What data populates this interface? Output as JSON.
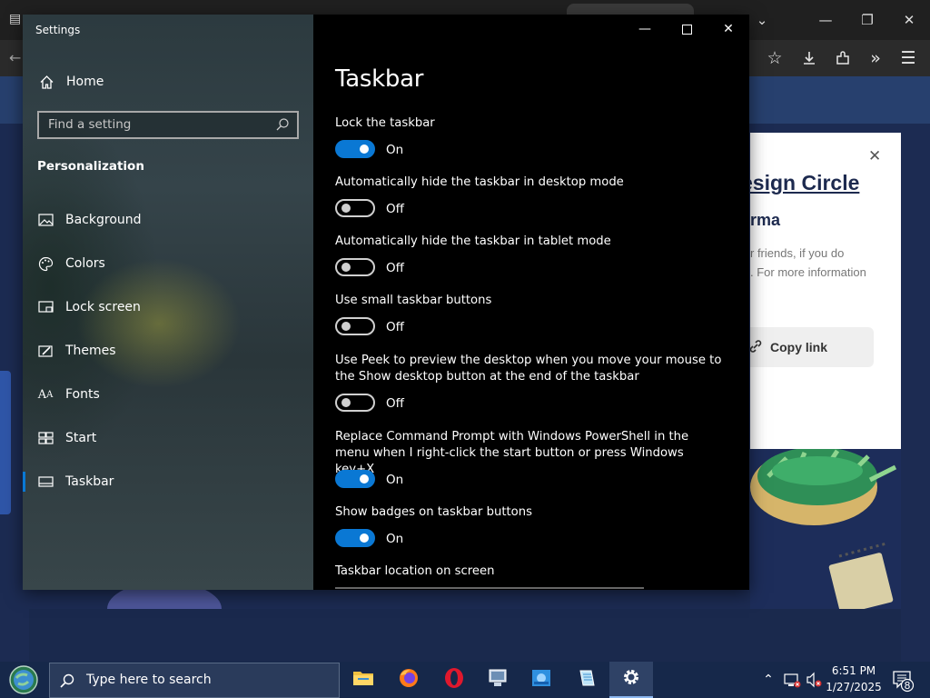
{
  "settings": {
    "window_title": "Settings",
    "nav": {
      "home": "Home",
      "search_placeholder": "Find a setting",
      "section": "Personalization",
      "items": [
        {
          "label": "Background",
          "icon": "picture-icon"
        },
        {
          "label": "Colors",
          "icon": "palette-icon"
        },
        {
          "label": "Lock screen",
          "icon": "lock-screen-icon"
        },
        {
          "label": "Themes",
          "icon": "brush-icon"
        },
        {
          "label": "Fonts",
          "icon": "fonts-icon"
        },
        {
          "label": "Start",
          "icon": "start-tiles-icon"
        },
        {
          "label": "Taskbar",
          "icon": "taskbar-icon",
          "selected": true
        }
      ]
    },
    "page": {
      "title": "Taskbar",
      "settings": [
        {
          "label": "Lock the taskbar",
          "state": "On"
        },
        {
          "label": "Automatically hide the taskbar in desktop mode",
          "state": "Off"
        },
        {
          "label": "Automatically hide the taskbar in tablet mode",
          "state": "Off"
        },
        {
          "label": "Use small taskbar buttons",
          "state": "Off"
        },
        {
          "label": "Use Peek to preview the desktop when you move your mouse to the Show desktop button at the end of the taskbar",
          "state": "Off"
        },
        {
          "label": "Replace Command Prompt with Windows PowerShell in the menu when I right-click the start button or press Windows key+X",
          "state": "On"
        },
        {
          "label": "Show badges on taskbar buttons",
          "state": "On"
        }
      ],
      "location_label": "Taskbar location on screen"
    },
    "accent_color": "#0a78d4"
  },
  "browser_page": {
    "card_title": "esign Circle",
    "card_subtitle": "rma",
    "card_text_1": "r friends, if you do",
    "card_text_2": ". For more information",
    "copy_link": "Copy link"
  },
  "taskbar": {
    "search_text": "Type here to search",
    "apps": [
      "file-explorer-icon",
      "firefox-icon",
      "opera-icon",
      "network-drive-icon",
      "photos-icon",
      "notepad-icon",
      "settings-gear-icon"
    ],
    "time": "6:51 PM",
    "date": "1/27/2025",
    "notification_count": "8"
  }
}
